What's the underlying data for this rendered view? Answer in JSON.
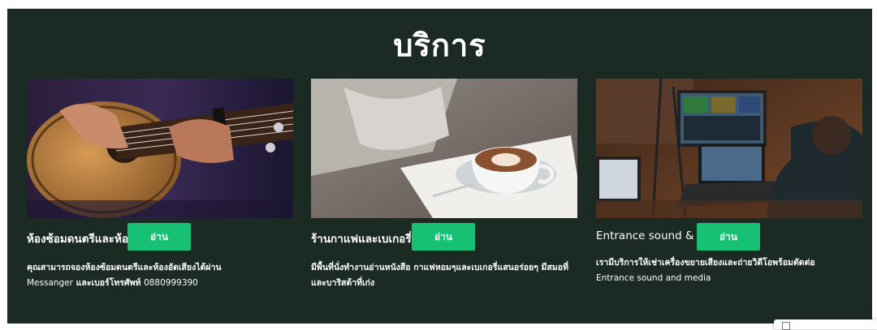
{
  "section": {
    "title": "บริการ"
  },
  "cards": [
    {
      "image": "acoustic-guitar-photo",
      "title": "ห้องซ้อมดนตรีและห้องอัดเสียง",
      "desc_bold": "คุณสามารถจองห้องซ้อมดนตรีและห้องอัดเสียงได้ผ่าน",
      "desc_line2_a": "Messanger",
      "desc_line2_b": " และเบอร์โทรศัพท์ ",
      "desc_line2_c": "0880999390",
      "button": "อ่าน"
    },
    {
      "image": "latte-art-coffee-photo",
      "title": "ร้านกาแฟและเบเกอรี่",
      "desc_bold": "มีพื้นที่นั่งทำงานอ่านหนังสือ กาแฟหอมๆและเบเกอรี่แสนอร่อยๆ มีสมอที่ และบาริสต้าที่เก่ง",
      "button": "อ่าน"
    },
    {
      "image": "video-mixing-laptop-photo",
      "title": "Entrance sound & media",
      "desc_bold": "เรามีบริการให้เช่าเครื่องขยายเสียงและถ่ายวิดีโอพร้อมตัดต่อ",
      "desc_line2": "Entrance sound and media",
      "button": "อ่าน"
    }
  ],
  "colors": {
    "section_bg": "#1b2a23",
    "button_bg": "#17c173",
    "text": "#ffffff"
  }
}
